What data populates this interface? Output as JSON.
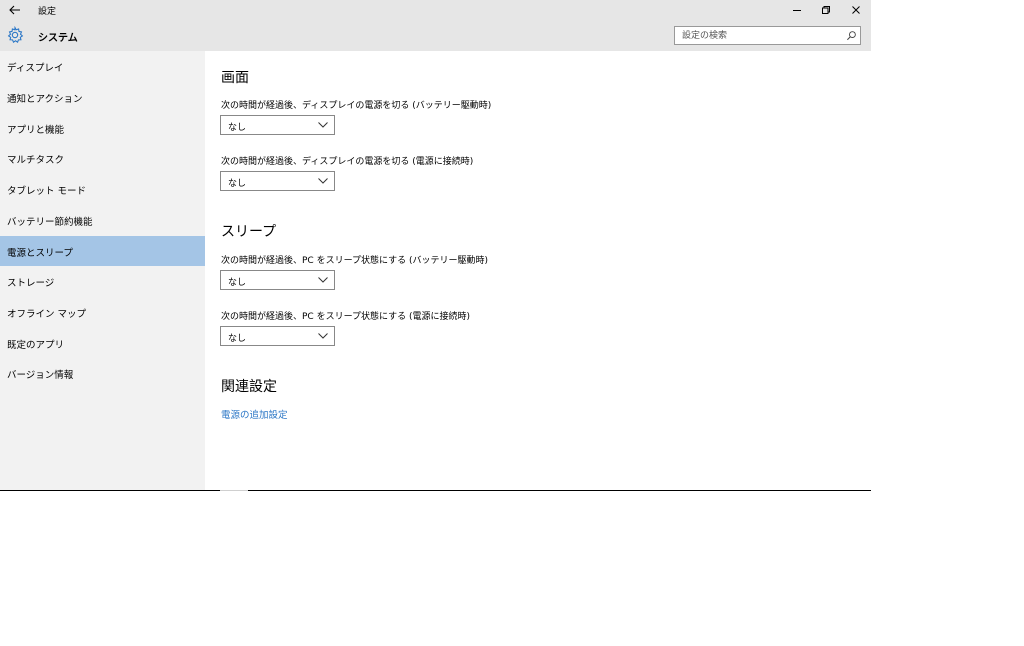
{
  "titlebar": {
    "title": "設定"
  },
  "header": {
    "section_title": "システム",
    "search_placeholder": "設定の検索"
  },
  "sidebar": {
    "items": [
      {
        "label": "ディスプレイ",
        "active": false
      },
      {
        "label": "通知とアクション",
        "active": false
      },
      {
        "label": "アプリと機能",
        "active": false
      },
      {
        "label": "マルチタスク",
        "active": false
      },
      {
        "label": "タブレット モード",
        "active": false
      },
      {
        "label": "バッテリー節約機能",
        "active": false
      },
      {
        "label": "電源とスリープ",
        "active": true
      },
      {
        "label": "ストレージ",
        "active": false
      },
      {
        "label": "オフライン マップ",
        "active": false
      },
      {
        "label": "既定のアプリ",
        "active": false
      },
      {
        "label": "バージョン情報",
        "active": false
      }
    ]
  },
  "main": {
    "screen": {
      "heading": "画面",
      "battery_label": "次の時間が経過後、ディスプレイの電源を切る (バッテリー駆動時)",
      "battery_value": "なし",
      "plugged_label": "次の時間が経過後、ディスプレイの電源を切る (電源に接続時)",
      "plugged_value": "なし"
    },
    "sleep": {
      "heading": "スリープ",
      "battery_label": "次の時間が経過後、PC をスリープ状態にする (バッテリー駆動時)",
      "battery_value": "なし",
      "plugged_label": "次の時間が経過後、PC をスリープ状態にする (電源に接続時)",
      "plugged_value": "なし"
    },
    "related": {
      "heading": "関連設定",
      "link": "電源の追加設定"
    }
  },
  "colors": {
    "accent": "#a4c5e6",
    "link": "#2a76c6",
    "chrome": "#e6e6e6",
    "sidebar": "#f2f2f2"
  }
}
